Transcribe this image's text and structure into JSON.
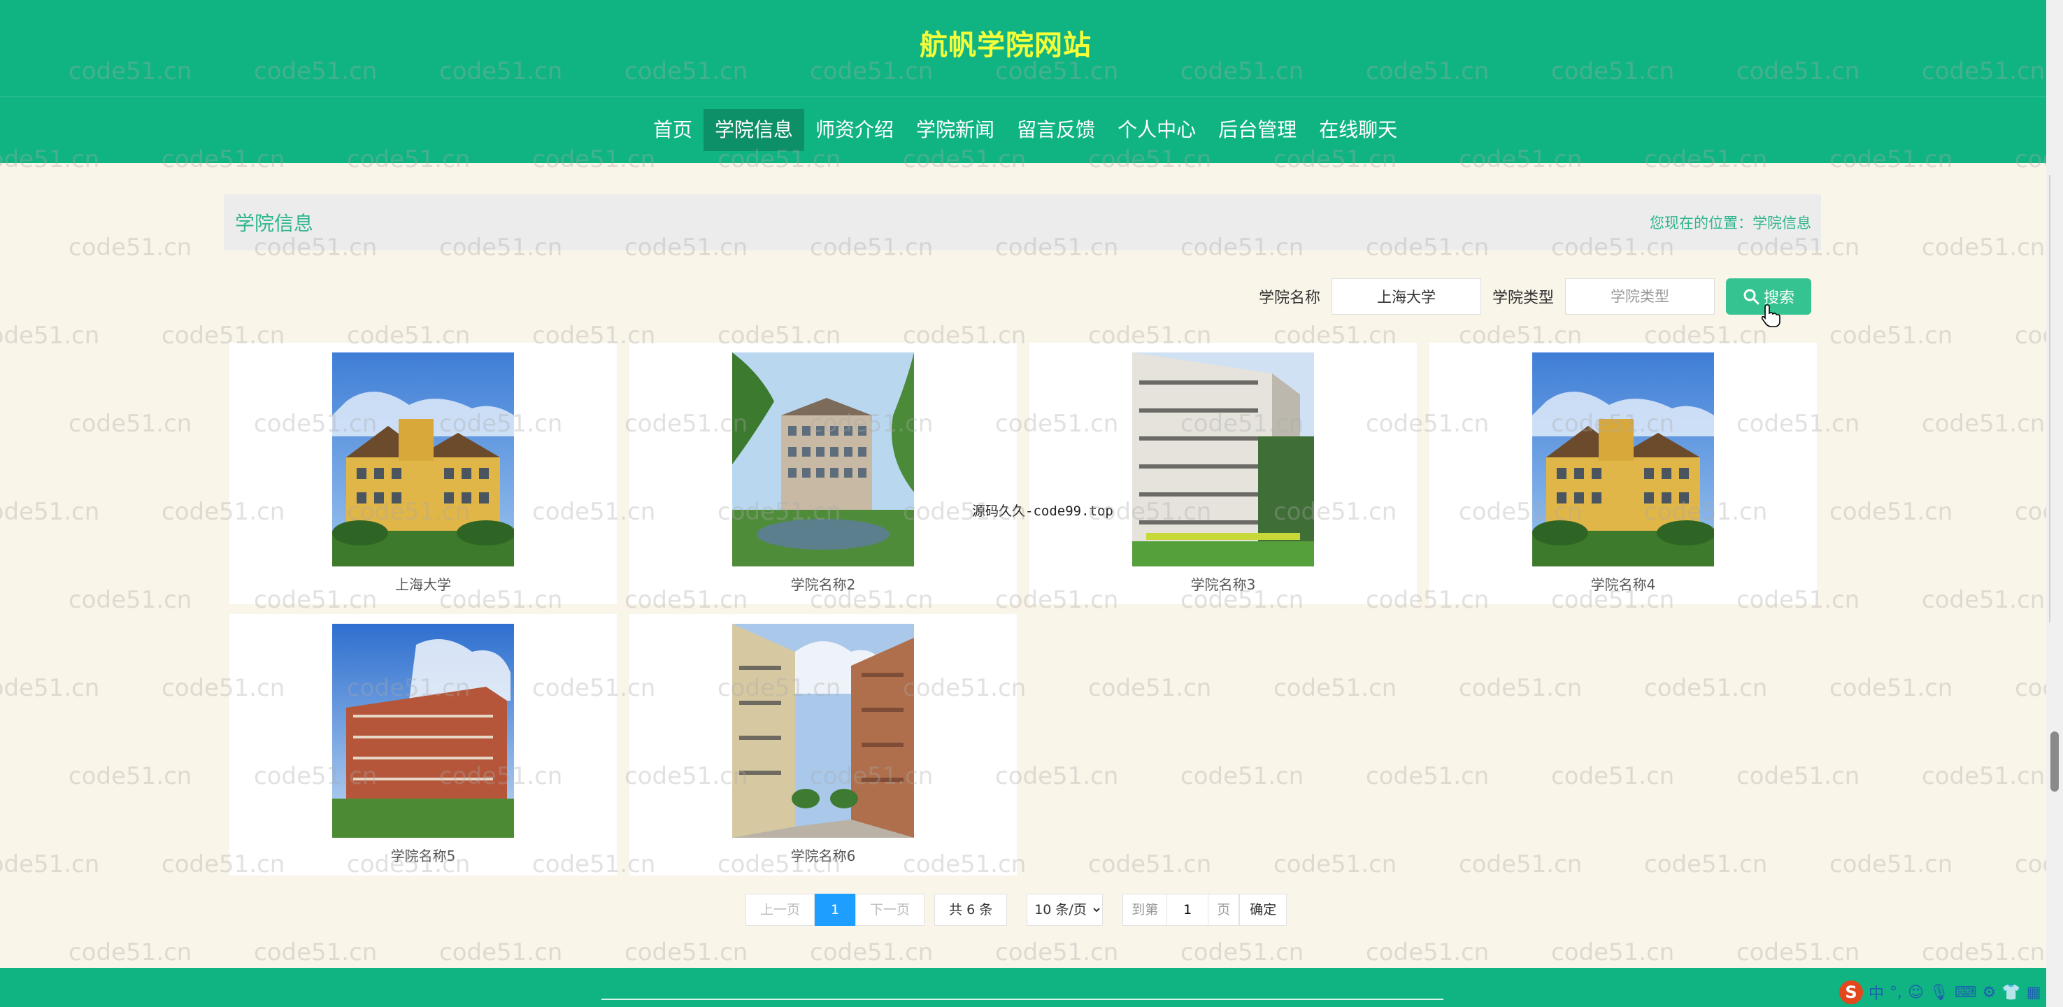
{
  "site": {
    "title": "航帆学院网站"
  },
  "nav": {
    "items": [
      {
        "label": "首页",
        "active": false
      },
      {
        "label": "学院信息",
        "active": true
      },
      {
        "label": "师资介绍",
        "active": false
      },
      {
        "label": "学院新闻",
        "active": false
      },
      {
        "label": "留言反馈",
        "active": false
      },
      {
        "label": "个人中心",
        "active": false
      },
      {
        "label": "后台管理",
        "active": false
      },
      {
        "label": "在线聊天",
        "active": false
      }
    ]
  },
  "page": {
    "section_title": "学院信息",
    "location_label": "您现在的位置：",
    "location_current": "学院信息"
  },
  "search": {
    "name_label": "学院名称",
    "name_value": "上海大学",
    "type_label": "学院类型",
    "type_placeholder": "学院类型",
    "button_label": "搜索"
  },
  "colleges": [
    {
      "name": "上海大学",
      "image": "campus-building-yellow"
    },
    {
      "name": "学院名称2",
      "image": "campus-building-lake"
    },
    {
      "name": "学院名称3",
      "image": "campus-dormitory-white"
    },
    {
      "name": "学院名称4",
      "image": "campus-building-yellow"
    },
    {
      "name": "学院名称5",
      "image": "campus-building-red"
    },
    {
      "name": "学院名称6",
      "image": "campus-walkway"
    }
  ],
  "pagination": {
    "prev_label": "上一页",
    "current_page": "1",
    "next_label": "下一页",
    "total_label": "共 6 条",
    "page_size_option": "10 条/页",
    "goto_label": "到第",
    "goto_value": "1",
    "page_unit": "页",
    "confirm_label": "确定"
  },
  "watermark": {
    "text": "code51.cn"
  },
  "overlay_note": "源码久久-code99.top",
  "tray": {
    "ime_label": "中"
  },
  "colors": {
    "brand": "#10b483",
    "accent": "#35c391",
    "page_bg": "#faf5e9",
    "title_yellow": "#f5ff3a",
    "pager_blue": "#1e9fff"
  }
}
